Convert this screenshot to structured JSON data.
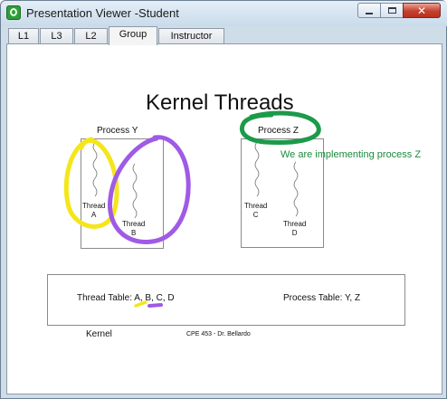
{
  "window": {
    "title": "Presentation Viewer -Student"
  },
  "tabs": [
    {
      "label": "L1"
    },
    {
      "label": "L3"
    },
    {
      "label": "L2"
    },
    {
      "label": "Group"
    },
    {
      "label": "Instructor"
    }
  ],
  "active_tab": "Group",
  "slide": {
    "title": "Kernel Threads",
    "process_y_label": "Process Y",
    "process_z_label": "Process Z",
    "thread_a": [
      "Thread",
      "A"
    ],
    "thread_b": [
      "Thread",
      "B"
    ],
    "thread_c": [
      "Thread",
      "C"
    ],
    "thread_d": [
      "Thread",
      "D"
    ],
    "thread_table": "Thread Table: A, B, C, D",
    "process_table": "Process Table: Y, Z",
    "kernel_label": "Kernel",
    "footer": "CPE 453 - Dr. Bellardo"
  },
  "annotations": {
    "note_text": "We are implementing process Z",
    "colors": {
      "yellow": "#f4e61a",
      "purple": "#a05ae6",
      "green": "#1c9a4a"
    }
  }
}
